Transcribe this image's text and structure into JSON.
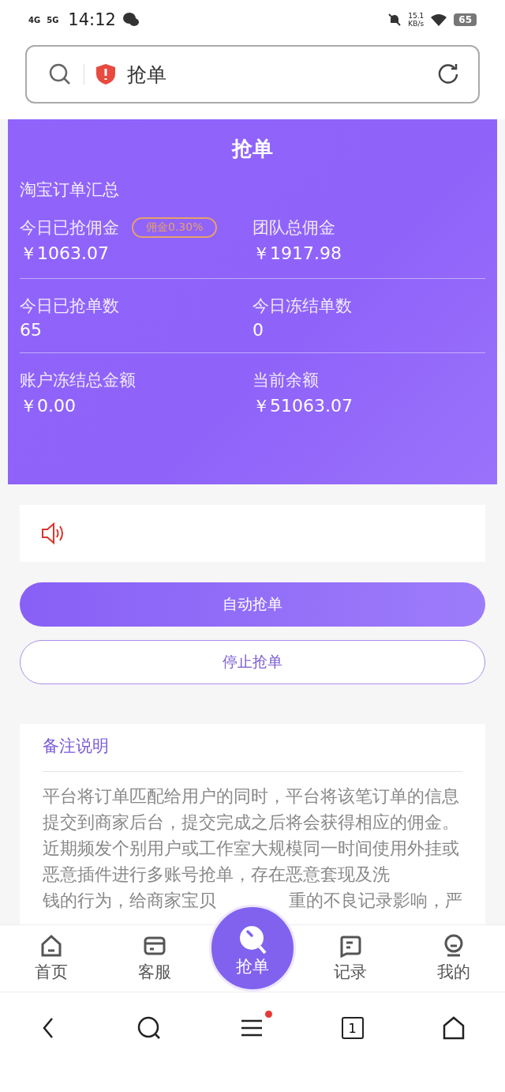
{
  "status_bar": {
    "network_1": "4G",
    "network_2": "5G",
    "time": "14:12",
    "speed": "15.1",
    "speed_unit": "KB/s",
    "battery": "65"
  },
  "address_bar": {
    "title": "抢单"
  },
  "header": {
    "title": "抢单",
    "subtitle": "淘宝订单汇总",
    "stats": [
      {
        "label": "今日已抢佣金",
        "badge": "佣金0.30%",
        "value": "￥1063.07"
      },
      {
        "label": "团队总佣金",
        "value": "￥1917.98"
      },
      {
        "label": "今日已抢单数",
        "value": "65"
      },
      {
        "label": "今日冻结单数",
        "value": "0"
      },
      {
        "label": "账户冻结总金额",
        "value": "￥0.00"
      },
      {
        "label": "当前余额",
        "value": "￥51063.07"
      }
    ]
  },
  "buttons": [
    {
      "label": "自动抢单",
      "kind": "primary"
    },
    {
      "label": "停止抢单",
      "kind": "outline"
    }
  ],
  "notes": {
    "title": "备注说明",
    "text": "平台将订单匹配给用户的同时，平台将该笔订单的信息提交到商家后台，提交完成之后将会获得相应的佣金。近期频发个别用户或工作室大规模同一时间使用外挂或恶意插件进行多账号抢单，存在恶意套现及洗",
    "partial_left": "钱的行为，给商家宝贝",
    "partial_right": "重的不良记录影响，严"
  },
  "tab_bar": [
    {
      "label": "首页",
      "kind": "home",
      "selected": false
    },
    {
      "label": "客服",
      "kind": "service",
      "selected": false
    },
    {
      "label": "抢单",
      "kind": "grab",
      "selected": true
    },
    {
      "label": "记录",
      "kind": "record",
      "selected": false
    },
    {
      "label": "我的",
      "kind": "me",
      "selected": false
    }
  ],
  "browser_bar": {
    "tabs_count": "1",
    "menu_badge": true
  }
}
